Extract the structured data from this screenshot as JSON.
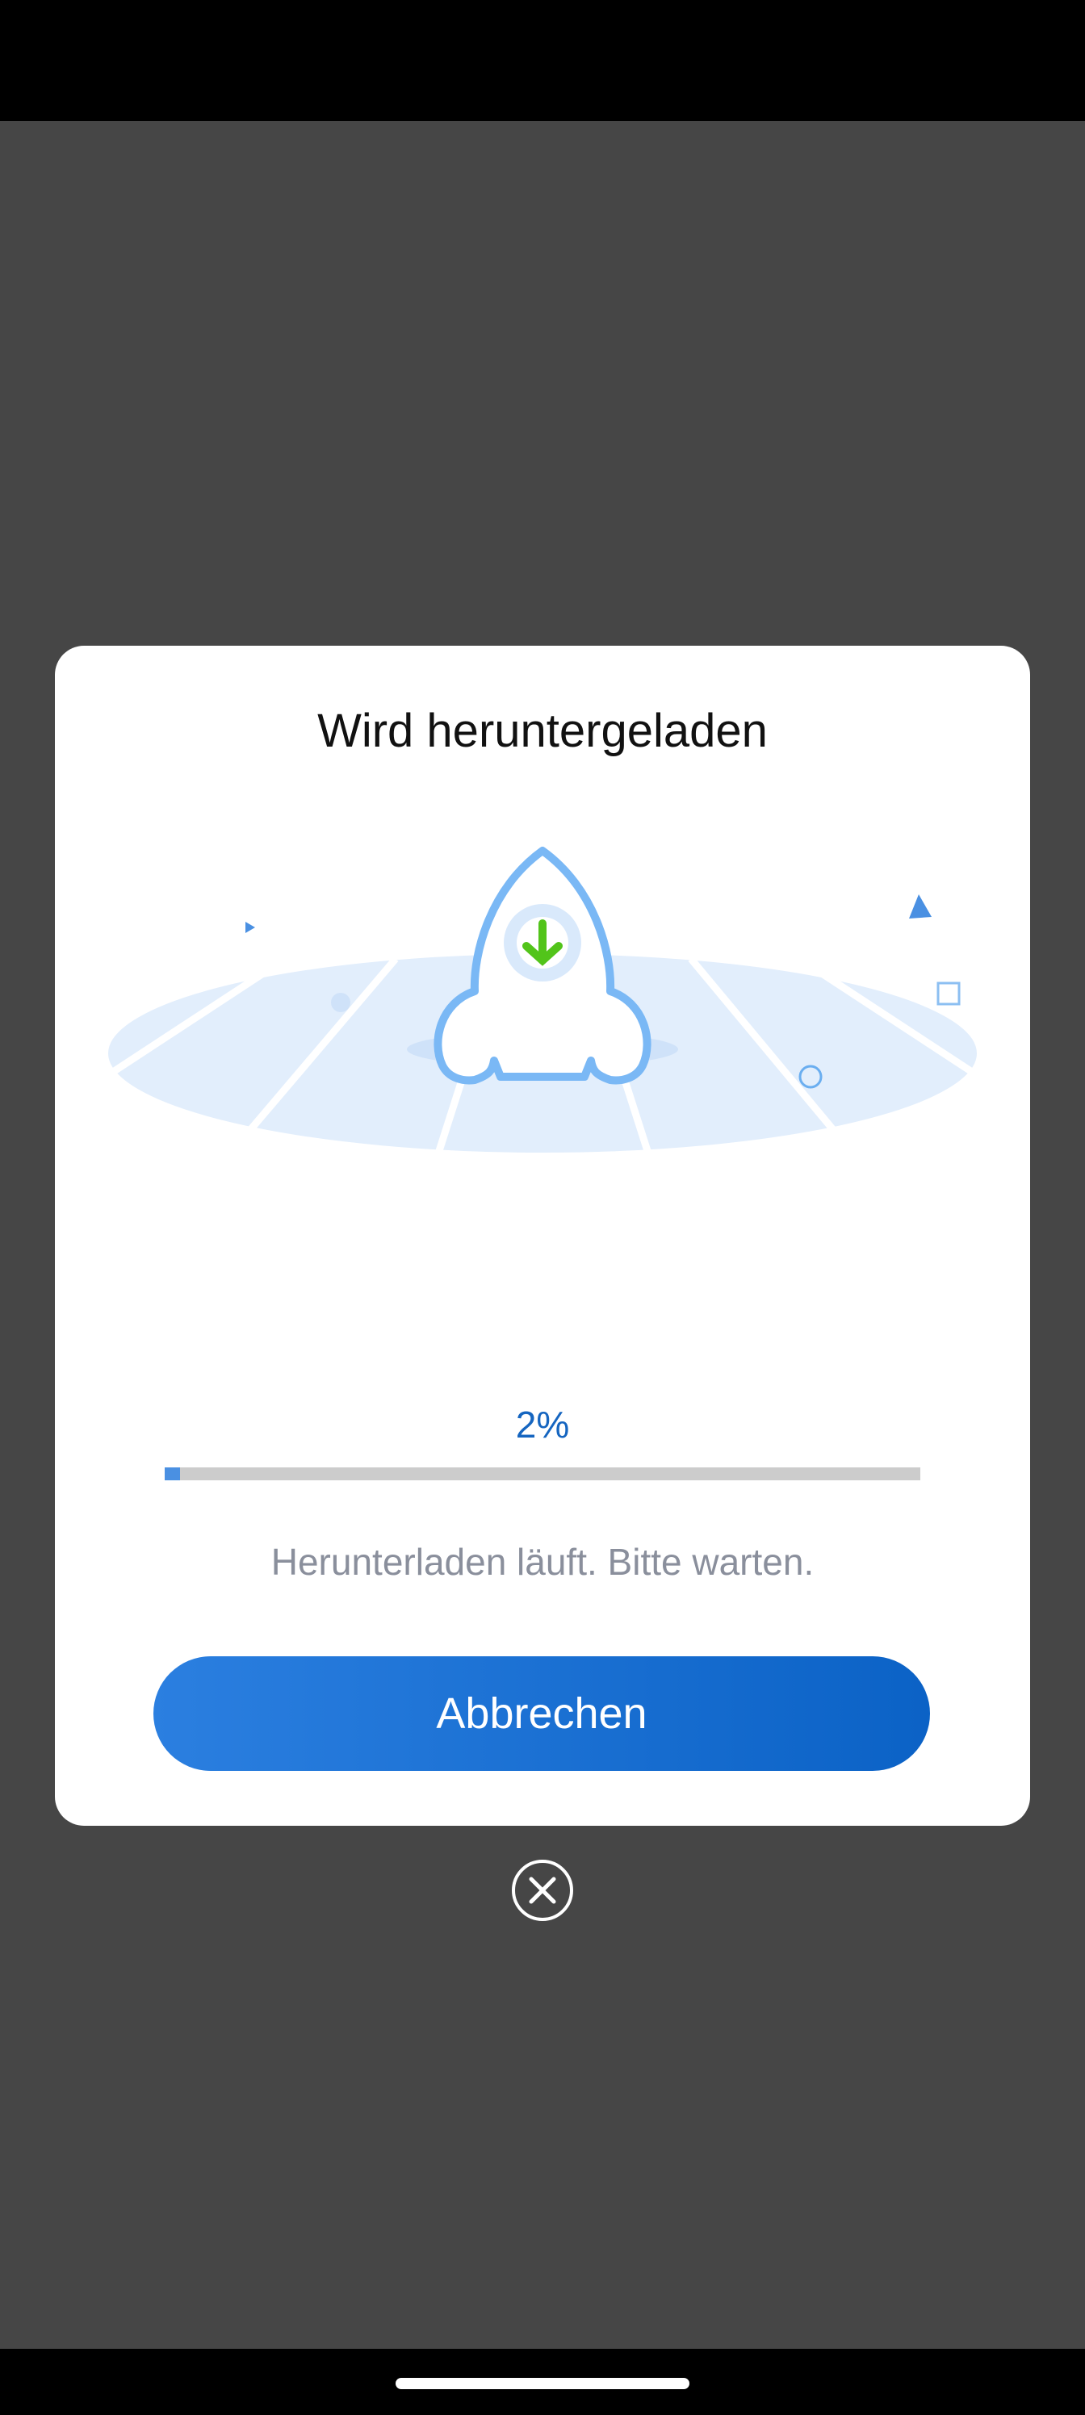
{
  "dialog": {
    "title": "Wird heruntergeladen",
    "progress": {
      "percent_label": "2%",
      "fraction": 0.02
    },
    "status_text": "Herunterladen läuft. Bitte warten.",
    "cancel_label": "Abbrechen"
  },
  "icons": {
    "illustration": "rocket-download-illustration",
    "close": "close-circle-icon"
  },
  "colors": {
    "accent": "#1565c0",
    "button_start": "#2b7fe0",
    "button_end": "#0b62c6",
    "progress_fill": "#4a90e2",
    "progress_track": "#cccccc",
    "overlay": "#464646",
    "download_arrow": "#52c41a"
  }
}
